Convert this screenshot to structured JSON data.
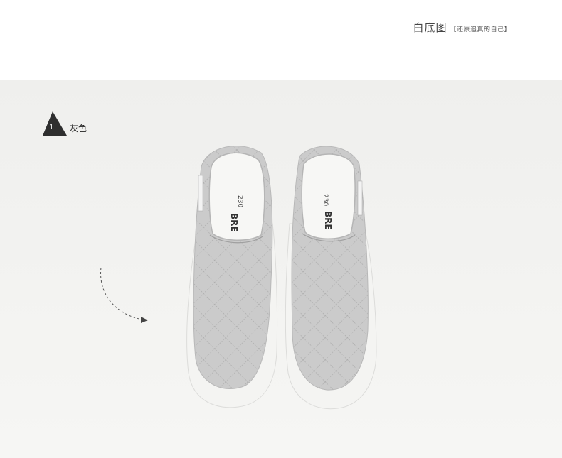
{
  "header": {
    "title": "白底图",
    "subtitle": "【还原追真的自己】"
  },
  "variant": {
    "number": "1",
    "color_label": "灰色"
  },
  "colors": {
    "shoe_fabric": "#c9c9c9",
    "sole": "#f4f4f2",
    "background": "#f1f1ef",
    "badge": "#2e2e2e"
  }
}
